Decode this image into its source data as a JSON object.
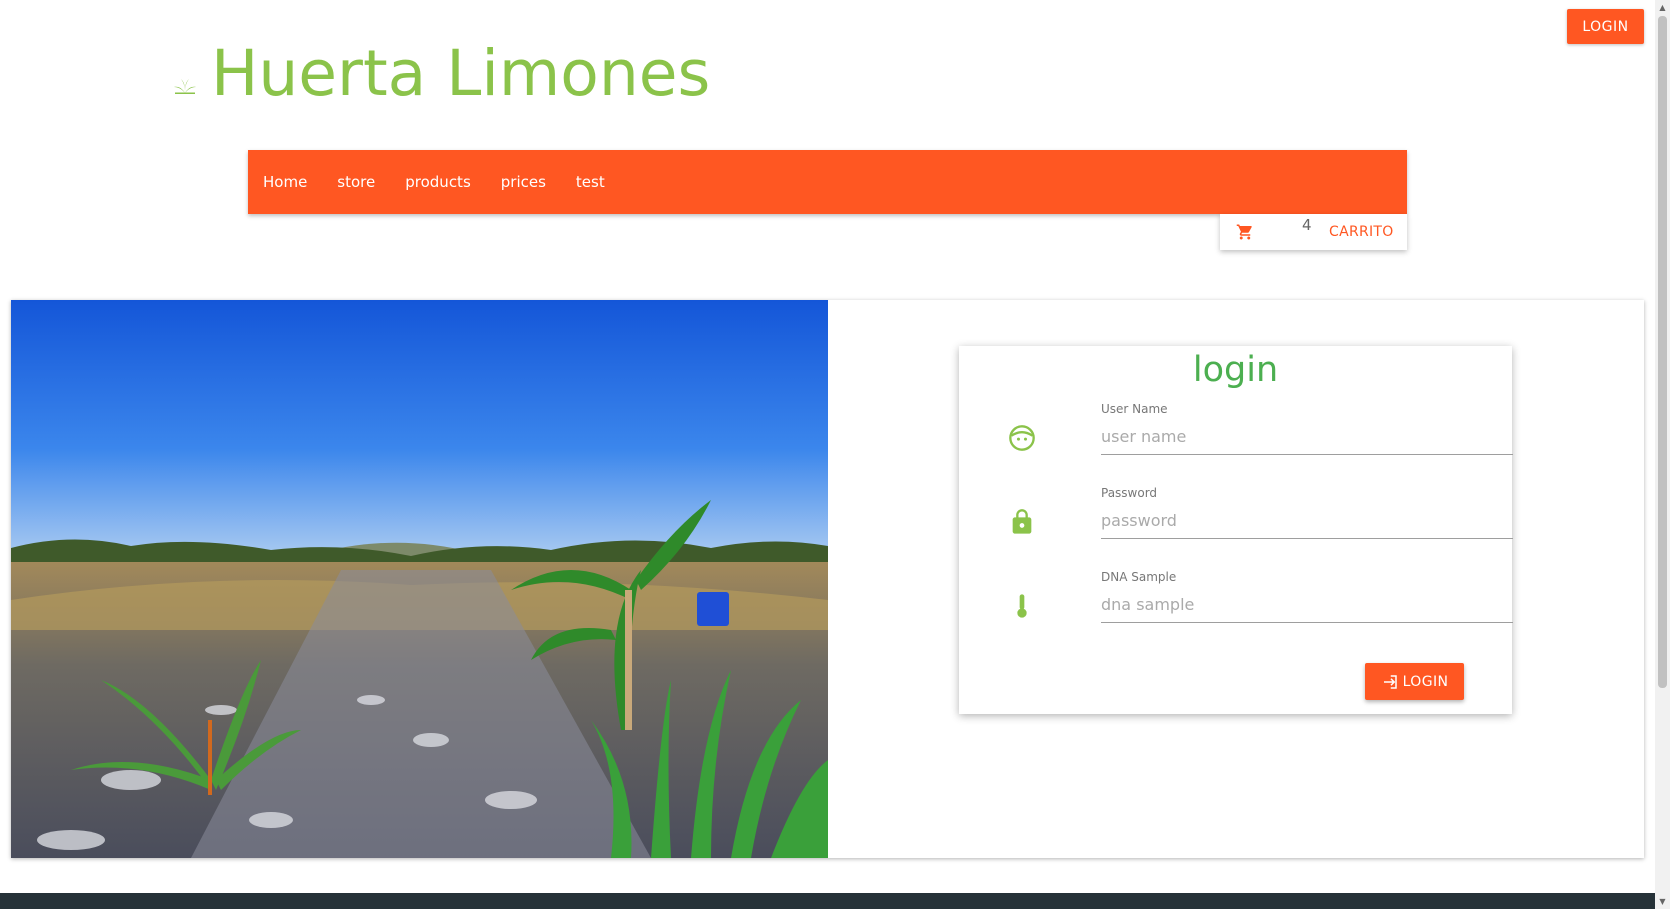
{
  "header": {
    "top_login_label": "LOGIN",
    "brand": "Huerta Limones",
    "logo_icon": "plant-sprout-icon"
  },
  "nav": {
    "items": [
      {
        "label": "Home"
      },
      {
        "label": "store"
      },
      {
        "label": "products"
      },
      {
        "label": "prices"
      },
      {
        "label": "test"
      }
    ]
  },
  "cart": {
    "icon": "shopping-cart-icon",
    "count": "4",
    "label": "CARRITO"
  },
  "photo": {
    "description_icon": "farm-landscape-image"
  },
  "login": {
    "title": "login",
    "fields": [
      {
        "label": "User Name",
        "placeholder": "user name",
        "icon": "face-icon"
      },
      {
        "label": "Password",
        "placeholder": "password",
        "icon": "lock-icon"
      },
      {
        "label": "DNA Sample",
        "placeholder": "dna sample",
        "icon": "thermometer-icon"
      }
    ],
    "submit_label": "LOGIN",
    "submit_icon": "login-arrow-icon"
  },
  "colors": {
    "accent": "#ff5722",
    "brand_green": "#8bc34a",
    "title_green": "#4caf50",
    "footer": "#263238"
  }
}
